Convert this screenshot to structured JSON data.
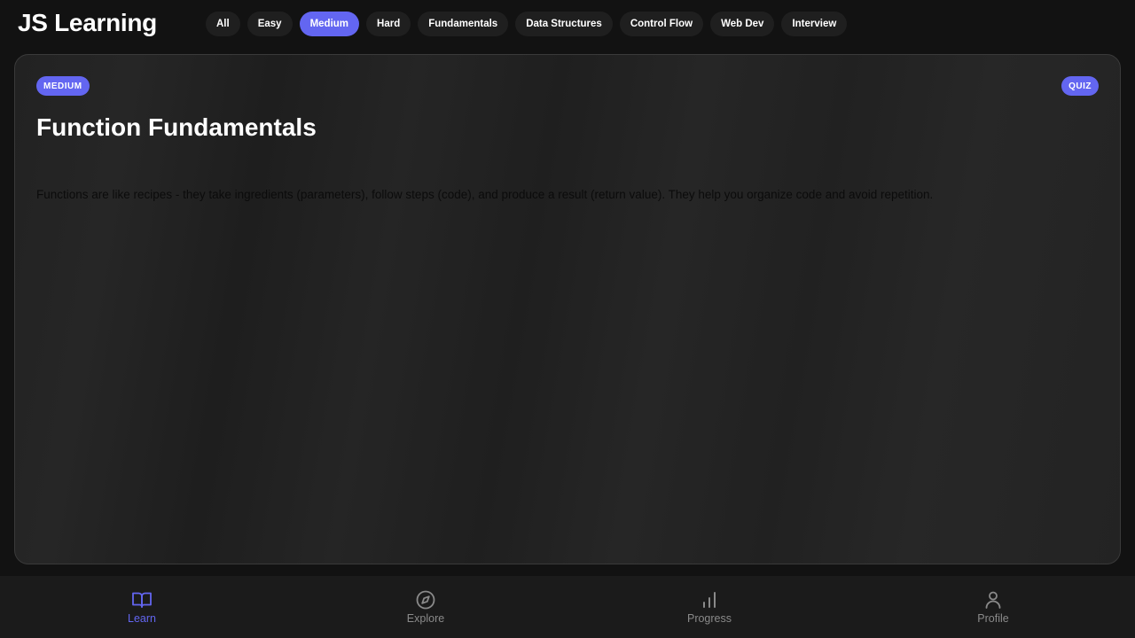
{
  "app": {
    "title": "JS Learning"
  },
  "filters": [
    {
      "label": "All",
      "active": false
    },
    {
      "label": "Easy",
      "active": false
    },
    {
      "label": "Medium",
      "active": true
    },
    {
      "label": "Hard",
      "active": false
    },
    {
      "label": "Fundamentals",
      "active": false
    },
    {
      "label": "Data Structures",
      "active": false
    },
    {
      "label": "Control Flow",
      "active": false
    },
    {
      "label": "Web Dev",
      "active": false
    },
    {
      "label": "Interview",
      "active": false
    }
  ],
  "card": {
    "difficulty": "MEDIUM",
    "type": "QUIZ",
    "title": "Function Fundamentals",
    "description": "Functions are like recipes - they take ingredients (parameters), follow steps (code), and produce a result (return value). They help you organize code and avoid repetition."
  },
  "nav": [
    {
      "label": "Learn",
      "icon": "book-icon",
      "active": true
    },
    {
      "label": "Explore",
      "icon": "compass-icon",
      "active": false
    },
    {
      "label": "Progress",
      "icon": "bar-chart-icon",
      "active": false
    },
    {
      "label": "Profile",
      "icon": "user-icon",
      "active": false
    }
  ],
  "colors": {
    "accent": "#6366f1",
    "background": "#121212",
    "nav_inactive": "#8a8a8a"
  }
}
